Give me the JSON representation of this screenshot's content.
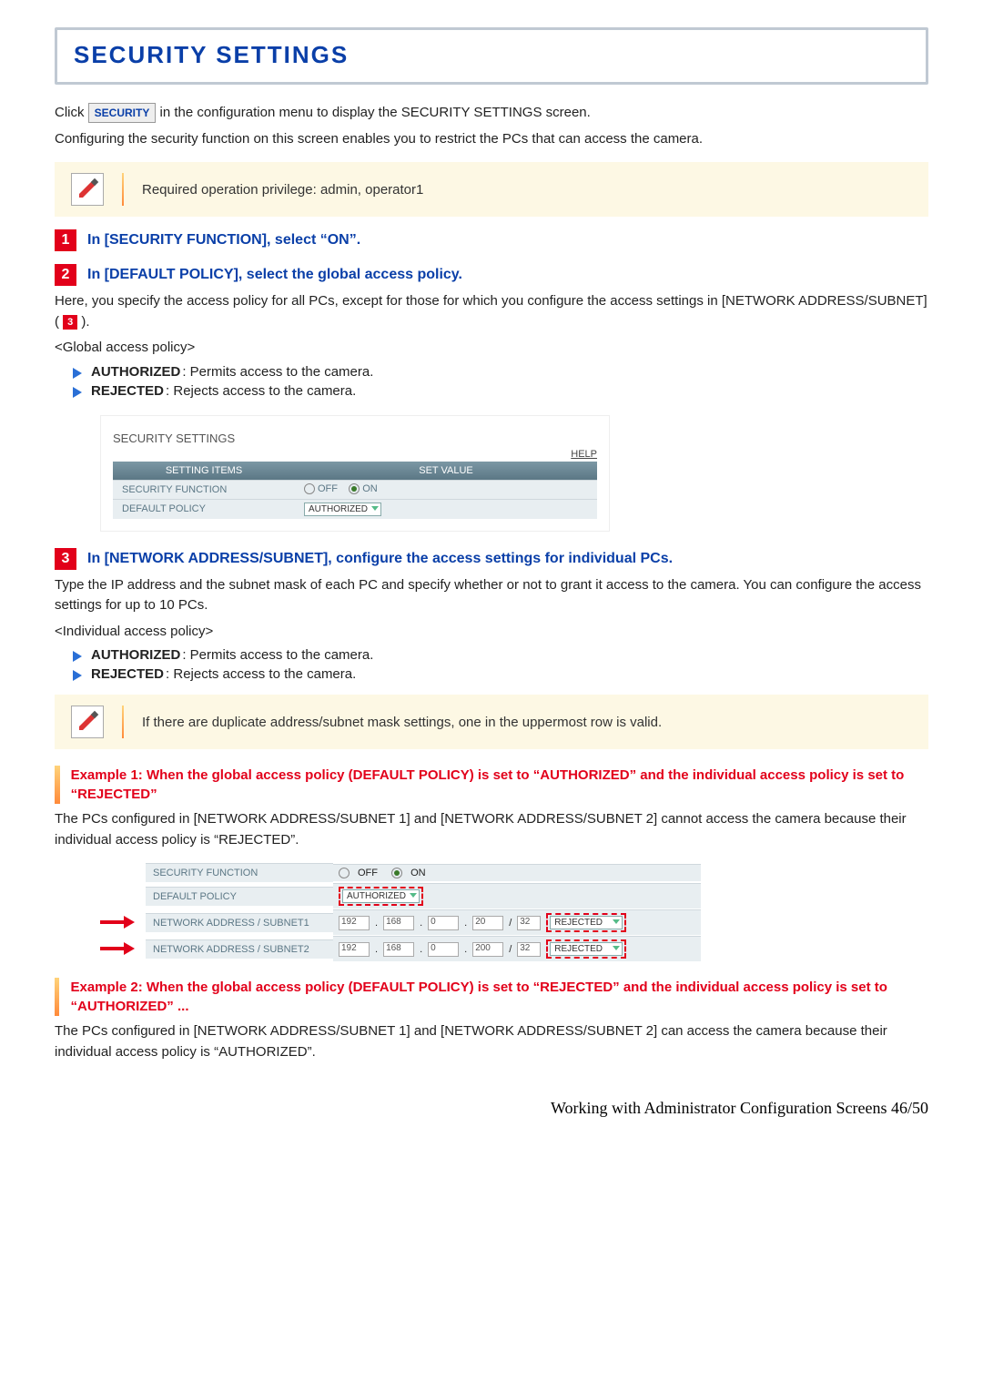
{
  "title": "SECURITY SETTINGS",
  "intro": {
    "p1a": "Click ",
    "btn": "SECURITY",
    "p1b": " in the configuration menu to display the SECURITY SETTINGS screen.",
    "p2": "Configuring the security function on this screen enables you to restrict the PCs that can access the camera."
  },
  "note1": "Required operation privilege: admin, operator1",
  "step1": {
    "num": "1",
    "title": "In [SECURITY FUNCTION], select “ON”."
  },
  "step2": {
    "num": "2",
    "title": "In [DEFAULT POLICY], select the global access policy.",
    "desc_a": "Here, you specify the access policy for all PCs, except for those for which you configure the access settings in [NETWORK ADDRESS/SUBNET] (",
    "inline": "3",
    "desc_b": ").",
    "sub": "<Global access policy>",
    "b1_label": "AUTHORIZED",
    "b1_text": ": Permits access to the camera.",
    "b2_label": "REJECTED",
    "b2_text": ": Rejects access to the camera."
  },
  "shot1": {
    "title": "SECURITY SETTINGS",
    "help": "HELP",
    "h1": "SETTING ITEMS",
    "h2": "SET VALUE",
    "r1_label": "SECURITY FUNCTION",
    "r1_off": "OFF",
    "r1_on": "ON",
    "r2_label": "DEFAULT POLICY",
    "r2_sel": "AUTHORIZED"
  },
  "step3": {
    "num": "3",
    "title": "In [NETWORK ADDRESS/SUBNET], configure the access settings for individual PCs.",
    "p1": "Type the IP address and the subnet mask of each PC and specify whether or not to grant it access to the camera. You can configure the access settings for up to 10 PCs.",
    "sub": "<Individual access policy>",
    "b1_label": "AUTHORIZED",
    "b1_text": ": Permits access to the camera.",
    "b2_label": "REJECTED",
    "b2_text": ": Rejects access to the camera."
  },
  "note2": "If there are duplicate address/subnet mask settings, one in the uppermost row is valid.",
  "ex1": {
    "title": "Example 1: When the global access policy (DEFAULT POLICY) is set to “AUTHORIZED” and the individual access policy is set to “REJECTED”",
    "body": "The PCs configured in [NETWORK ADDRESS/SUBNET 1] and [NETWORK ADDRESS/SUBNET 2] cannot access the camera because their individual access policy is “REJECTED”."
  },
  "shot2": {
    "r1_label": "SECURITY FUNCTION",
    "off": "OFF",
    "on": "ON",
    "r2_label": "DEFAULT POLICY",
    "r2_sel": "AUTHORIZED",
    "r3_label": "NETWORK ADDRESS / SUBNET1",
    "r4_label": "NETWORK ADDRESS / SUBNET2",
    "ip1": [
      "192",
      "168",
      "0",
      "20"
    ],
    "mask1": "32",
    "pol1": "REJECTED",
    "ip2": [
      "192",
      "168",
      "0",
      "200"
    ],
    "mask2": "32",
    "pol2": "REJECTED",
    "slash": "/",
    "dot": "."
  },
  "ex2": {
    "title": "Example 2: When the global access policy (DEFAULT POLICY) is set to “REJECTED” and the individual access policy is set to “AUTHORIZED” ...",
    "body": "The PCs configured in [NETWORK ADDRESS/SUBNET 1] and [NETWORK ADDRESS/SUBNET 2] can access the camera because their individual access policy is “AUTHORIZED”."
  },
  "footer": "Working with Administrator Configuration Screens 46/50"
}
